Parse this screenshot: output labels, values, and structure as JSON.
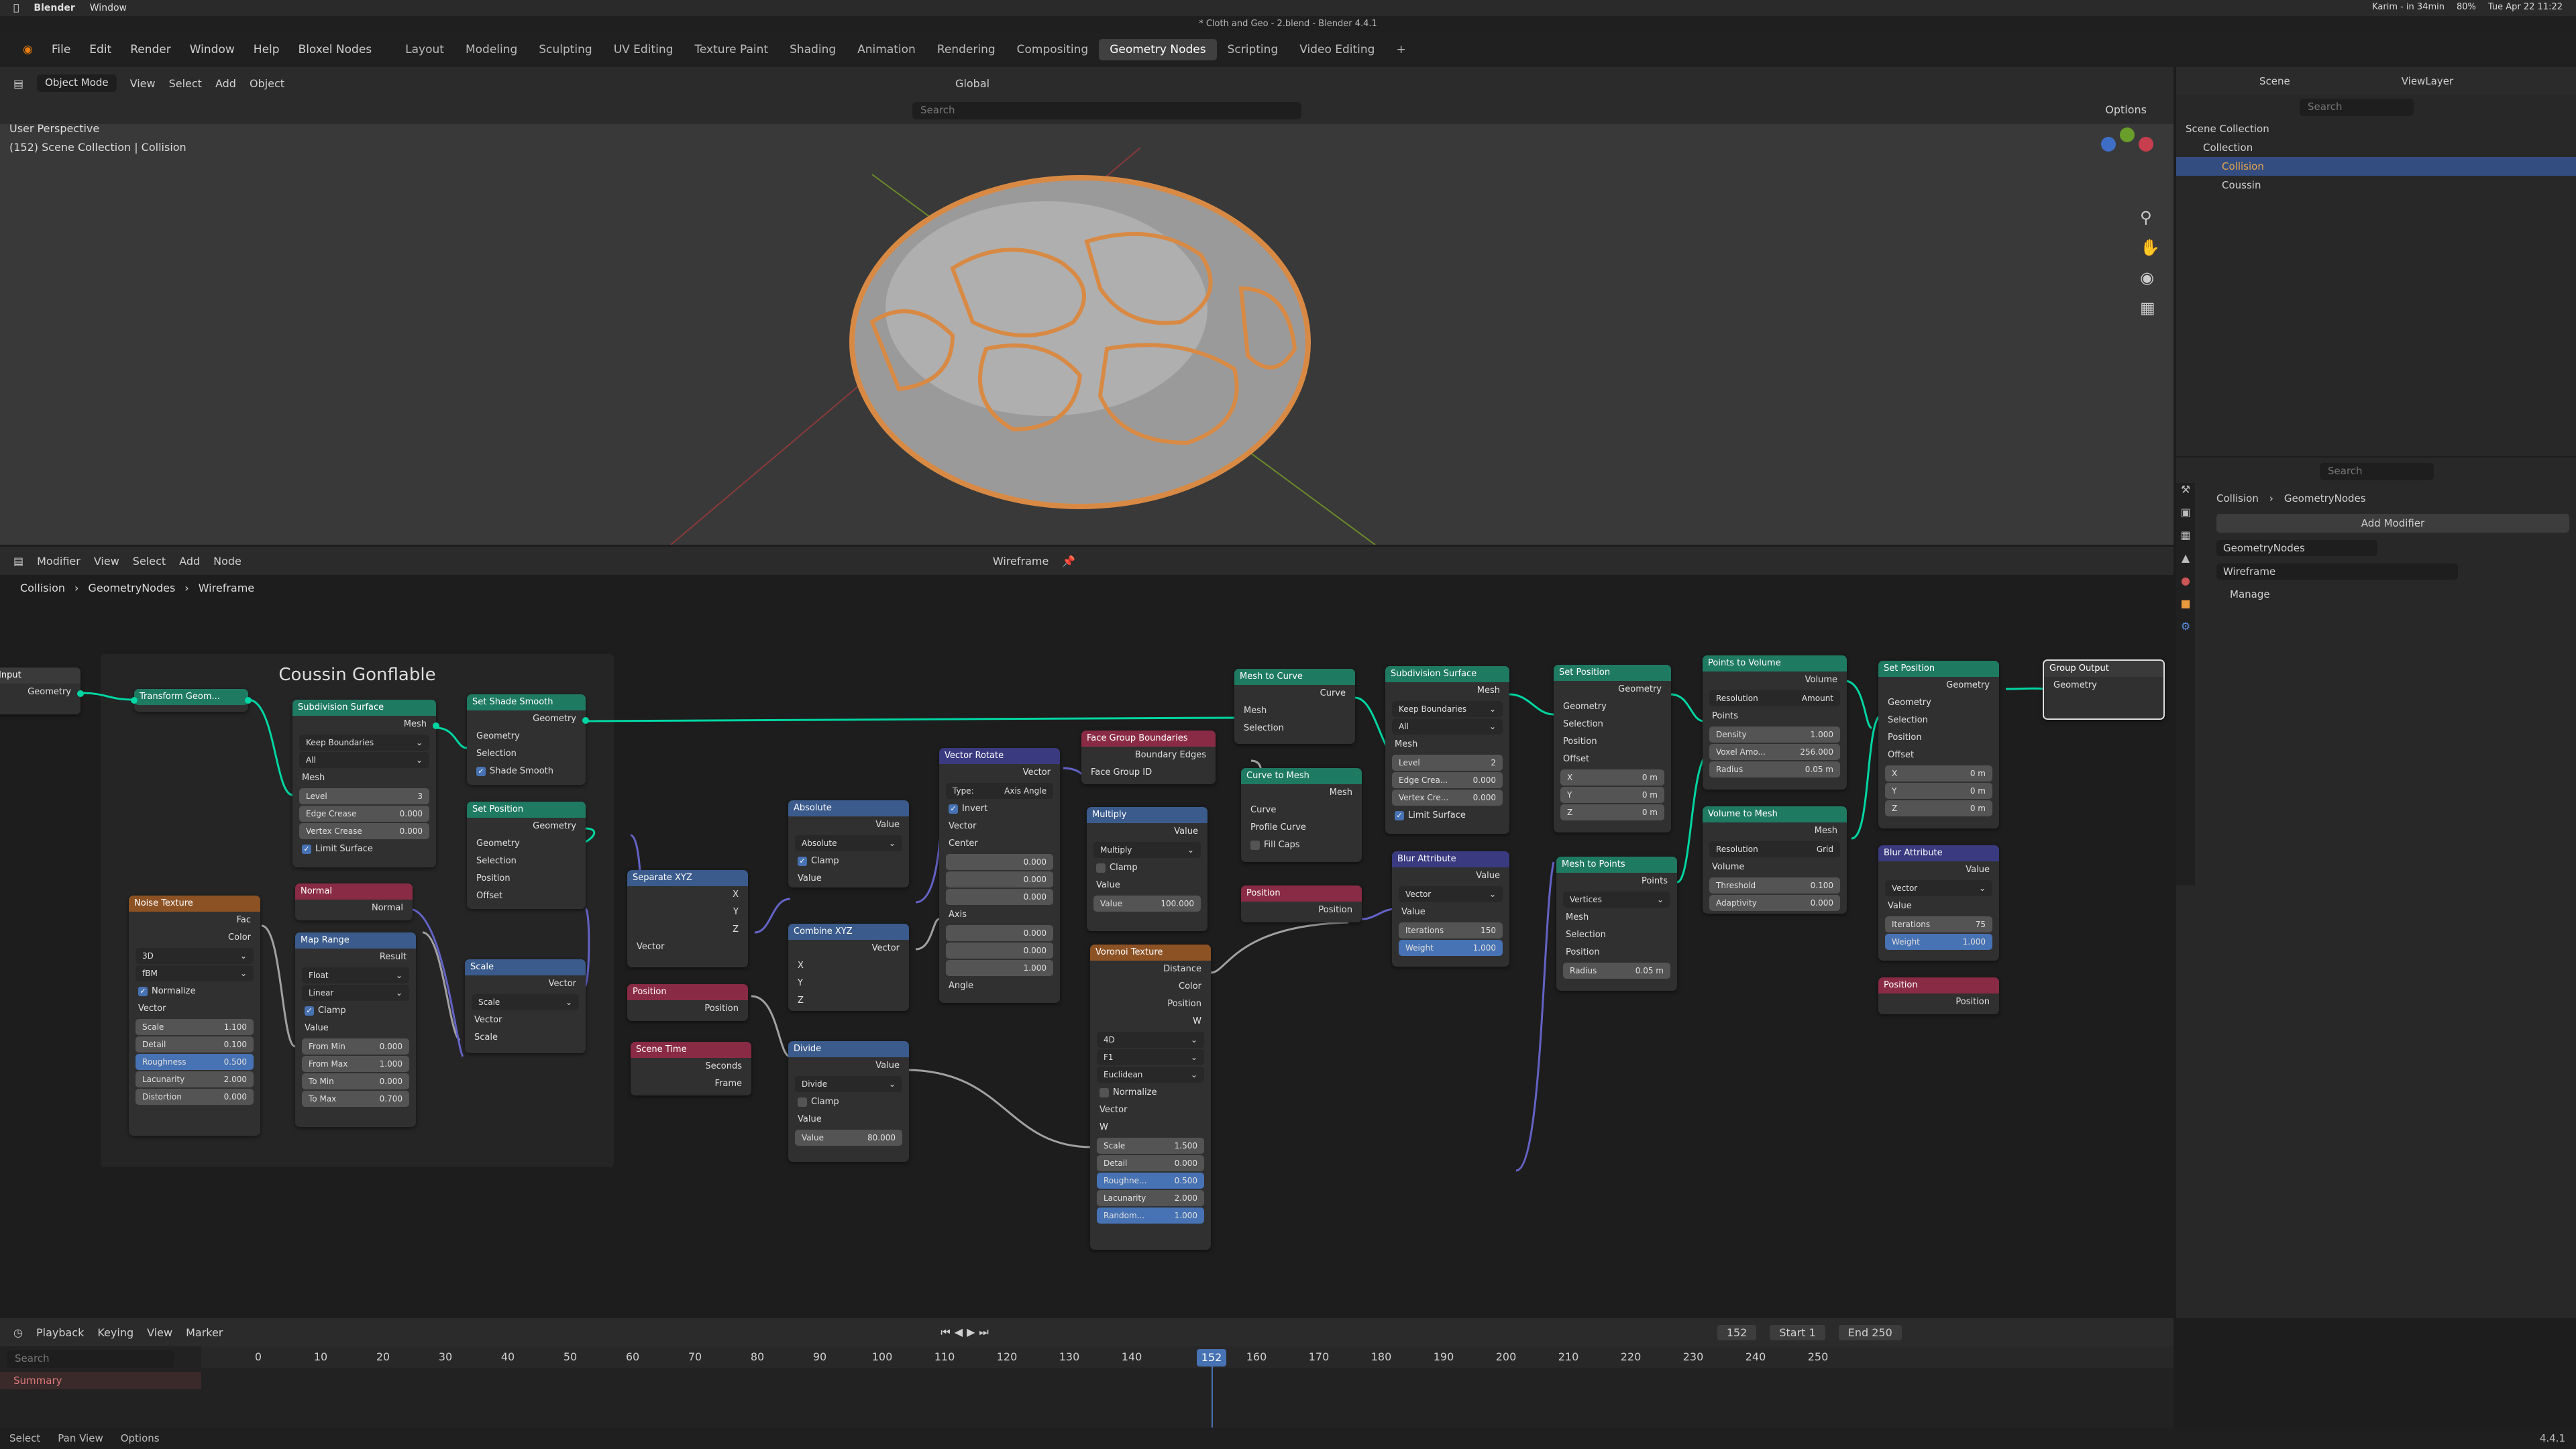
{
  "mac_menu": {
    "app": "Blender",
    "items": [
      "Window"
    ],
    "user_status": "Karim - in 34min",
    "date": "Tue Apr 22 11:22",
    "battery": "80%"
  },
  "window_title": "* Cloth and Geo - 2.blend - Blender 4.4.1",
  "menu": {
    "items": [
      "File",
      "Edit",
      "Render",
      "Window",
      "Help",
      "Bloxel Nodes"
    ],
    "workspaces": [
      "Layout",
      "Modeling",
      "Sculpting",
      "UV Editing",
      "Texture Paint",
      "Shading",
      "Animation",
      "Rendering",
      "Compositing",
      "Geometry Nodes",
      "Scripting",
      "Video Editing"
    ],
    "active_workspace": "Geometry Nodes"
  },
  "viewport": {
    "mode": "Object Mode",
    "menus": [
      "View",
      "Select",
      "Add",
      "Object"
    ],
    "orientation": "Global",
    "search_placeholder": "Search",
    "info_line1": "User Perspective",
    "info_line2": "(152) Scene Collection | Collision",
    "options": "Options"
  },
  "outliner": {
    "scene": "Scene",
    "view_layer": "ViewLayer",
    "search_placeholder": "Search",
    "items": [
      "Scene Collection",
      "Collection",
      "Collision",
      "Coussin"
    ]
  },
  "properties": {
    "search_placeholder": "Search",
    "breadcrumb_obj": "Collision",
    "breadcrumb_mod": "GeometryNodes",
    "add_modifier": "Add Modifier",
    "modifier_name": "GeometryNodes",
    "node_group": "Wireframe",
    "manage": "Manage"
  },
  "node_editor": {
    "menus": [
      "Modifier",
      "View",
      "Select",
      "Add",
      "Node"
    ],
    "tree_name": "Wireframe",
    "breadcrumb": [
      "Collision",
      "GeometryNodes",
      "Wireframe"
    ],
    "frame_title": "Coussin Gonflable"
  },
  "nodes": {
    "group_input": {
      "title": "Input",
      "geometry": "Geometry"
    },
    "transform": {
      "title": "Transform Geom..."
    },
    "subdiv1": {
      "title": "Subdivision Surface",
      "mesh": "Mesh",
      "keep": "Keep Boundaries",
      "all": "All",
      "mesh_in": "Mesh",
      "level_l": "Level",
      "level": "3",
      "edge_l": "Edge Crease",
      "edge": "0.000",
      "vert_l": "Vertex Crease",
      "vert": "0.000",
      "limit": "Limit Surface"
    },
    "shade": {
      "title": "Set Shade Smooth",
      "geometry": "Geometry",
      "geometry_in": "Geometry",
      "selection": "Selection",
      "smooth": "Shade Smooth"
    },
    "setpos1": {
      "title": "Set Position",
      "geometry": "Geometry",
      "geometry_in": "Geometry",
      "selection": "Selection",
      "position": "Position",
      "offset": "Offset"
    },
    "normal": {
      "title": "Normal",
      "normal": "Normal"
    },
    "noise": {
      "title": "Noise Texture",
      "fac": "Fac",
      "color": "Color",
      "dim": "3D",
      "type": "fBM",
      "normalize": "Normalize",
      "vector": "Vector",
      "scale_l": "Scale",
      "scale": "1.100",
      "detail_l": "Detail",
      "detail": "0.100",
      "rough_l": "Roughness",
      "rough": "0.500",
      "lac_l": "Lacunarity",
      "lac": "2.000",
      "dist_l": "Distortion",
      "dist": "0.000"
    },
    "maprange": {
      "title": "Map Range",
      "result": "Result",
      "float": "Float",
      "linear": "Linear",
      "clamp": "Clamp",
      "value": "Value",
      "fmin_l": "From Min",
      "fmin": "0.000",
      "fmax_l": "From Max",
      "fmax": "1.000",
      "tmin_l": "To Min",
      "tmin": "0.000",
      "tmax_l": "To Max",
      "tmax": "0.700"
    },
    "scale": {
      "title": "Scale",
      "vector": "Vector",
      "mode": "Scale",
      "vector_in": "Vector",
      "scale": "Scale"
    },
    "sepxyz": {
      "title": "Separate XYZ",
      "x": "X",
      "y": "Y",
      "z": "Z",
      "vector": "Vector"
    },
    "position1": {
      "title": "Position",
      "position": "Position"
    },
    "scenetime": {
      "title": "Scene Time",
      "seconds": "Seconds",
      "frame": "Frame"
    },
    "absolute": {
      "title": "Absolute",
      "value": "Value",
      "mode": "Absolute",
      "clamp": "Clamp",
      "value_in": "Value"
    },
    "combine": {
      "title": "Combine XYZ",
      "vector": "Vector",
      "x": "X",
      "y": "Y",
      "z": "Z"
    },
    "divide": {
      "title": "Divide",
      "value": "Value",
      "mode": "Divide",
      "clamp": "Clamp",
      "value_in": "Value",
      "v2_l": "Value",
      "v2": "80.000"
    },
    "vrot": {
      "title": "Vector Rotate",
      "vector": "Vector",
      "type_l": "Type:",
      "type": "Axis Angle",
      "invert": "Invert",
      "vector_in": "Vector",
      "center": "Center",
      "c": [
        "0.000",
        "0.000",
        "0.000"
      ],
      "axis": "Axis",
      "a": [
        "0.000",
        "0.000",
        "1.000"
      ],
      "angle": "Angle"
    },
    "facegroup": {
      "title": "Face Group Boundaries",
      "edges": "Boundary Edges",
      "fgid": "Face Group ID"
    },
    "multiply": {
      "title": "Multiply",
      "value": "Value",
      "mode": "Multiply",
      "clamp": "Clamp",
      "value_in": "Value",
      "v2_l": "Value",
      "v2": "100.000"
    },
    "voronoi": {
      "title": "Voronoi Texture",
      "distance": "Distance",
      "color": "Color",
      "position": "Position",
      "w": "W",
      "dim": "4D",
      "feature": "F1",
      "metric": "Euclidean",
      "normalize": "Normalize",
      "vector": "Vector",
      "w_in": "W",
      "scale_l": "Scale",
      "scale": "1.500",
      "detail_l": "Detail",
      "detail": "0.000",
      "rough_l": "Roughne...",
      "rough": "0.500",
      "lac_l": "Lacunarity",
      "lac": "2.000",
      "rand_l": "Random...",
      "rand": "1.000"
    },
    "m2c": {
      "title": "Mesh to Curve",
      "curve": "Curve",
      "mesh": "Mesh",
      "selection": "Selection"
    },
    "c2m": {
      "title": "Curve to Mesh",
      "mesh": "Mesh",
      "curve": "Curve",
      "profile": "Profile Curve",
      "fill": "Fill Caps"
    },
    "position2": {
      "title": "Position",
      "position": "Position"
    },
    "subdiv2": {
      "title": "Subdivision Surface",
      "mesh": "Mesh",
      "keep": "Keep Boundaries",
      "all": "All",
      "mesh_in": "Mesh",
      "level_l": "Level",
      "level": "2",
      "edge_l": "Edge Crea...",
      "edge": "0.000",
      "vert_l": "Vertex Cre...",
      "vert": "0.000",
      "limit": "Limit Surface"
    },
    "blur1": {
      "title": "Blur Attribute",
      "value": "Value",
      "type": "Vector",
      "value_in": "Value",
      "iter_l": "Iterations",
      "iter": "150",
      "weight_l": "Weight",
      "weight": "1.000"
    },
    "setpos2": {
      "title": "Set Position",
      "geometry": "Geometry",
      "geometry_in": "Geometry",
      "selection": "Selection",
      "position": "Position",
      "offset": "Offset",
      "x": "0 m",
      "y": "0 m",
      "z": "0 m"
    },
    "m2p": {
      "title": "Mesh to Points",
      "points": "Points",
      "mode": "Vertices",
      "mesh": "Mesh",
      "selection": "Selection",
      "position": "Position",
      "radius_l": "Radius",
      "radius": "0.05 m"
    },
    "p2v": {
      "title": "Points to Volume",
      "volume": "Volume",
      "res_l": "Resolution",
      "res": "Amount",
      "points": "Points",
      "dens_l": "Density",
      "dens": "1.000",
      "vox_l": "Voxel Amo...",
      "vox": "256.000",
      "rad_l": "Radius",
      "rad": "0.05 m"
    },
    "v2m": {
      "title": "Volume to Mesh",
      "mesh": "Mesh",
      "res_l": "Resolution",
      "res": "Grid",
      "volume": "Volume",
      "thr_l": "Threshold",
      "thr": "0.100",
      "ad_l": "Adaptivity",
      "ad": "0.000"
    },
    "setpos3": {
      "title": "Set Position",
      "geometry": "Geometry",
      "geometry_in": "Geometry",
      "selection": "Selection",
      "position": "Position",
      "offset": "Offset",
      "x": "0 m",
      "y": "0 m",
      "z": "0 m"
    },
    "blur2": {
      "title": "Blur Attribute",
      "value": "Value",
      "type": "Vector",
      "value_in": "Value",
      "iter_l": "Iterations",
      "iter": "75",
      "weight_l": "Weight",
      "weight": "1.000"
    },
    "position3": {
      "title": "Position",
      "position": "Position"
    },
    "group_output": {
      "title": "Group Output",
      "geometry": "Geometry"
    }
  },
  "timeline": {
    "menus": [
      "Playback",
      "Keying",
      "View",
      "Marker"
    ],
    "current": "152",
    "start_l": "Start",
    "start": "1",
    "end_l": "End",
    "end": "250",
    "ticks": [
      "0",
      "10",
      "20",
      "30",
      "40",
      "50",
      "60",
      "70",
      "80",
      "90",
      "100",
      "110",
      "120",
      "130",
      "140",
      "150",
      "160",
      "170",
      "180",
      "190",
      "200",
      "210",
      "220",
      "230",
      "240",
      "250"
    ],
    "search_placeholder": "Search",
    "summary": "Summary"
  },
  "status": {
    "select": "Select",
    "pan": "Pan View",
    "options": "Options",
    "version": "4.4.1"
  }
}
